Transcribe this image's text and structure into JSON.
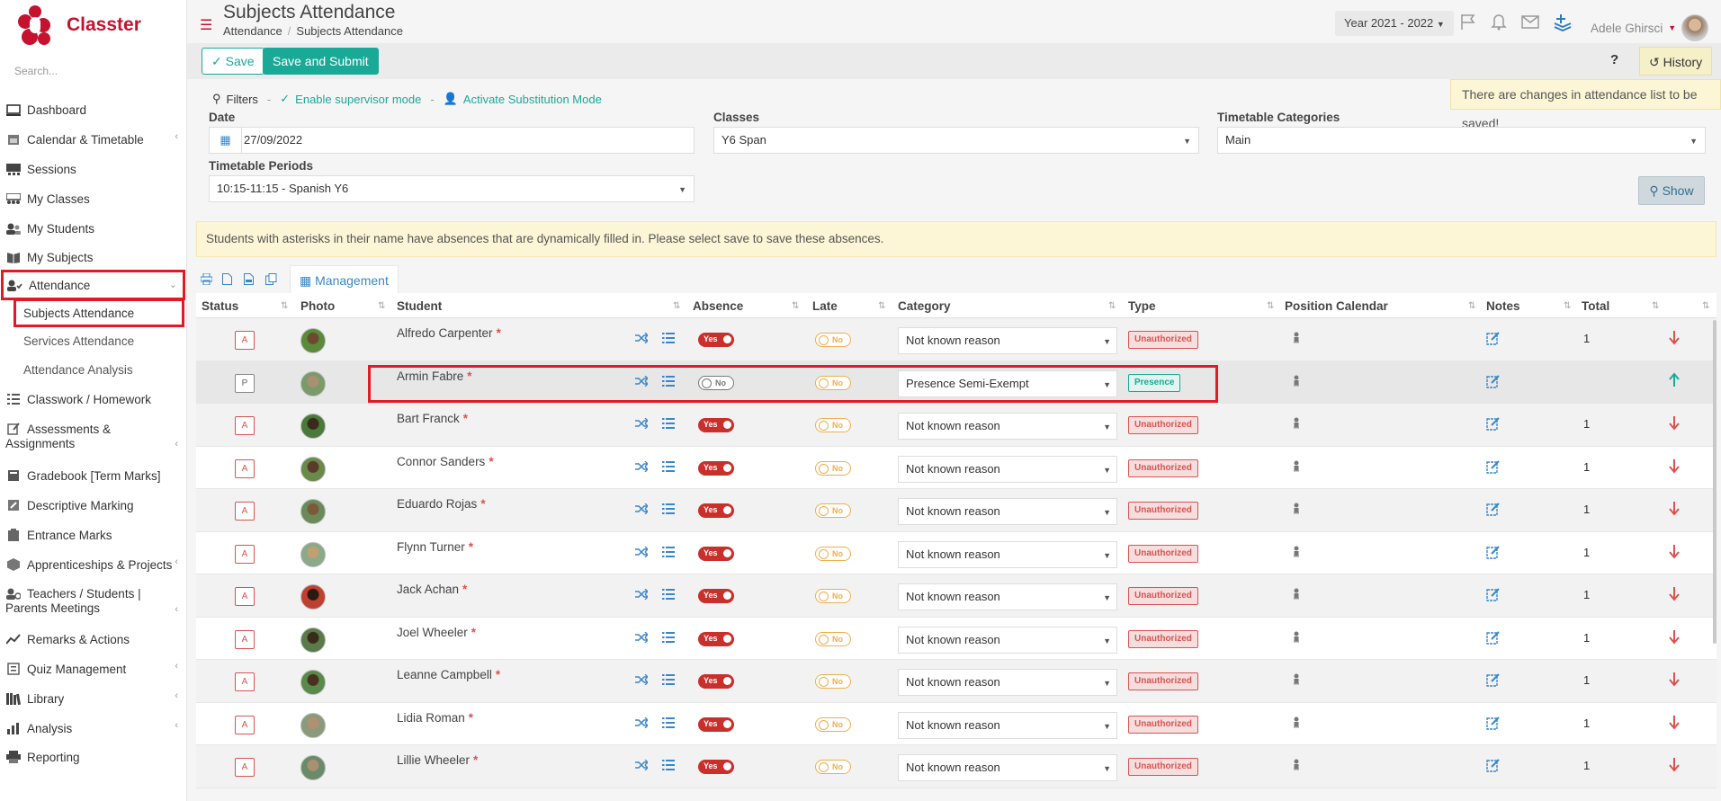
{
  "app": {
    "name": "Classter",
    "brand_color": "#c4122f",
    "accent_color": "#1aa997"
  },
  "sidebar": {
    "search_placeholder": "Search...",
    "items": [
      {
        "label": "Dashboard",
        "icon": "monitor-icon"
      },
      {
        "label": "Calendar & Timetable",
        "icon": "calendar-icon"
      },
      {
        "label": "Sessions",
        "icon": "sessions-icon"
      },
      {
        "label": "My Classes",
        "icon": "classes-icon"
      },
      {
        "label": "My Students",
        "icon": "students-icon"
      },
      {
        "label": "My Subjects",
        "icon": "book-icon"
      },
      {
        "label": "Attendance",
        "icon": "user-check-icon"
      },
      {
        "label": "Subjects Attendance"
      },
      {
        "label": "Services Attendance"
      },
      {
        "label": "Attendance Analysis"
      },
      {
        "label": "Classwork / Homework",
        "icon": "list-icon"
      },
      {
        "label": "Assessments &",
        "label2": "Assignments",
        "icon": "edit-icon"
      },
      {
        "label": "Gradebook [Term Marks]",
        "icon": "gradebook-icon"
      },
      {
        "label": "Descriptive Marking",
        "icon": "pencil-square-icon"
      },
      {
        "label": "Entrance Marks",
        "icon": "clipboard-icon"
      },
      {
        "label": "Apprenticeships & Projects",
        "icon": "cube-icon"
      },
      {
        "label": "Teachers / Students |",
        "label2": "Parents Meetings",
        "icon": "meeting-icon"
      },
      {
        "label": "Remarks & Actions",
        "icon": "remarks-icon"
      },
      {
        "label": "Quiz Management",
        "icon": "quiz-icon"
      },
      {
        "label": "Library",
        "icon": "library-icon"
      },
      {
        "label": "Analysis",
        "icon": "bar-chart-icon"
      },
      {
        "label": "Reporting",
        "icon": "printer-icon"
      }
    ]
  },
  "header": {
    "title": "Subjects Attendance",
    "breadcrumb": [
      "Attendance",
      "Subjects Attendance"
    ],
    "year": "Year 2021 - 2022",
    "user": "Adele Ghirsci"
  },
  "toolbar": {
    "save": "Save",
    "submit": "Save and Submit",
    "help": "?",
    "history": "History"
  },
  "warning": "There are changes in attendance list to be saved!",
  "filters": {
    "title": "Filters",
    "supervisor": "Enable supervisor mode",
    "substitution": "Activate Substitution Mode",
    "date_label": "Date",
    "date_value": "27/09/2022",
    "classes_label": "Classes",
    "classes_value": "Y6 Span",
    "categories_label": "Timetable Categories",
    "categories_value": "Main",
    "periods_label": "Timetable Periods",
    "periods_value": "10:15-11:15 - Spanish Y6",
    "show": "Show"
  },
  "notice": "Students with asterisks in their name have absences that are dynamically filled in. Please select save to save these absences.",
  "tabs": {
    "management": "Management"
  },
  "table": {
    "columns": [
      "Status",
      "Photo",
      "Student",
      "Absence",
      "Late",
      "Category",
      "Type",
      "Position Calendar",
      "Notes",
      "Total"
    ],
    "rows": [
      {
        "status": "A",
        "student": "Alfredo Carpenter",
        "absence": "Yes",
        "late": "No",
        "category": "Not known reason",
        "type": "Unauthorized",
        "total": "1",
        "arrow": "down"
      },
      {
        "status": "P",
        "student": "Armin Fabre",
        "absence": "No",
        "late": "No",
        "category": "Presence Semi-Exempt",
        "type": "Presence",
        "total": "",
        "arrow": "up"
      },
      {
        "status": "A",
        "student": "Bart Franck",
        "absence": "Yes",
        "late": "No",
        "category": "Not known reason",
        "type": "Unauthorized",
        "total": "1",
        "arrow": "down"
      },
      {
        "status": "A",
        "student": "Connor Sanders",
        "absence": "Yes",
        "late": "No",
        "category": "Not known reason",
        "type": "Unauthorized",
        "total": "1",
        "arrow": "down"
      },
      {
        "status": "A",
        "student": "Eduardo Rojas",
        "absence": "Yes",
        "late": "No",
        "category": "Not known reason",
        "type": "Unauthorized",
        "total": "1",
        "arrow": "down"
      },
      {
        "status": "A",
        "student": "Flynn Turner",
        "absence": "Yes",
        "late": "No",
        "category": "Not known reason",
        "type": "Unauthorized",
        "total": "1",
        "arrow": "down"
      },
      {
        "status": "A",
        "student": "Jack Achan",
        "absence": "Yes",
        "late": "No",
        "category": "Not known reason",
        "type": "Unauthorized",
        "total": "1",
        "arrow": "down"
      },
      {
        "status": "A",
        "student": "Joel Wheeler",
        "absence": "Yes",
        "late": "No",
        "category": "Not known reason",
        "type": "Unauthorized",
        "total": "1",
        "arrow": "down"
      },
      {
        "status": "A",
        "student": "Leanne Campbell",
        "absence": "Yes",
        "late": "No",
        "category": "Not known reason",
        "type": "Unauthorized",
        "total": "1",
        "arrow": "down"
      },
      {
        "status": "A",
        "student": "Lidia Roman",
        "absence": "Yes",
        "late": "No",
        "category": "Not known reason",
        "type": "Unauthorized",
        "total": "1",
        "arrow": "down"
      },
      {
        "status": "A",
        "student": "Lillie Wheeler",
        "absence": "Yes",
        "late": "No",
        "category": "Not known reason",
        "type": "Unauthorized",
        "total": "1",
        "arrow": "down"
      }
    ]
  }
}
